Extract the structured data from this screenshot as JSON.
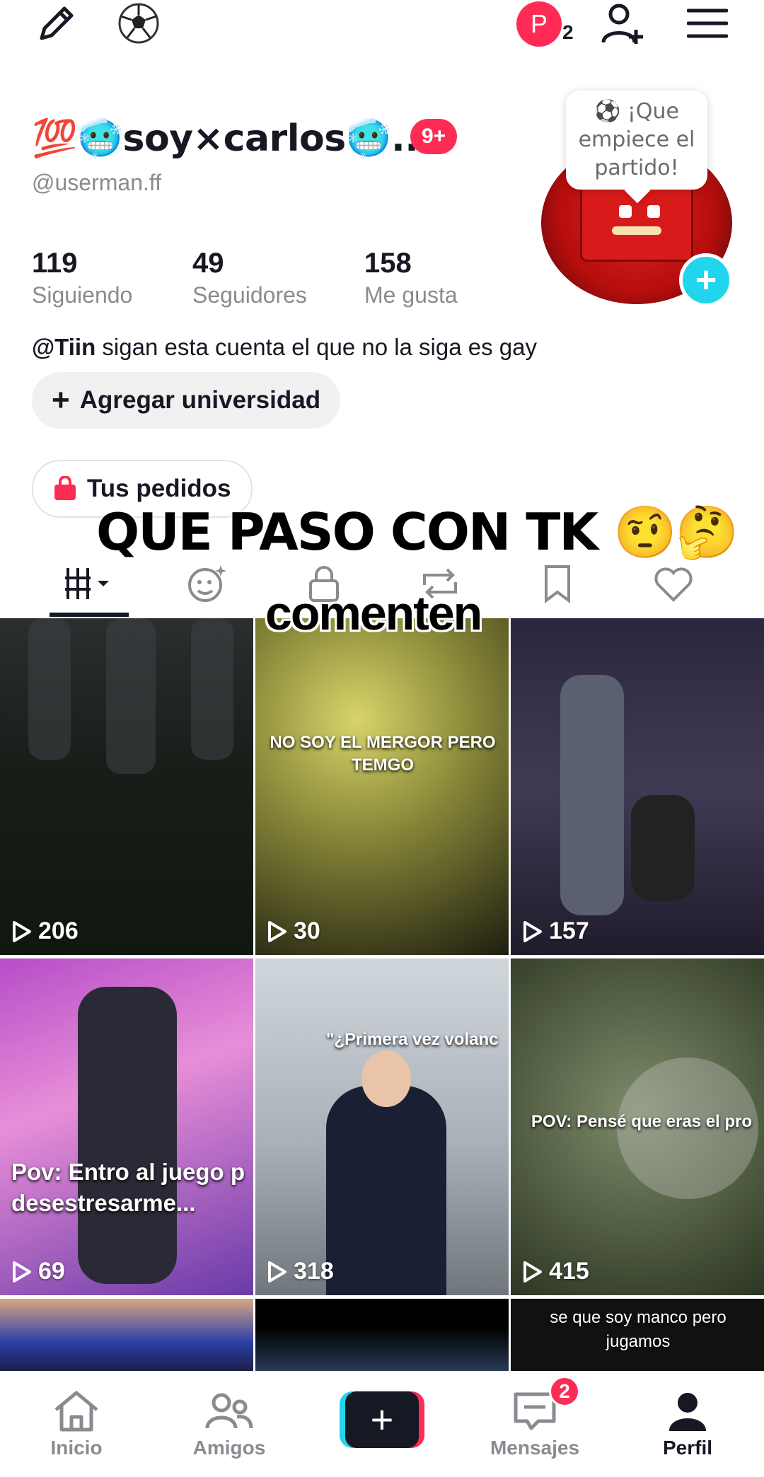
{
  "header": {
    "icons": {
      "edit": "pencil-icon",
      "ball": "soccer-ball-icon",
      "add_user": "add-user-icon",
      "menu": "menu-icon"
    },
    "account_initial": "P",
    "account_count": "2"
  },
  "profile": {
    "display_name": "💯🥶soy×carlos🥶...",
    "name_badge": "9+",
    "username": "@userman.ff",
    "bubble_text": "⚽ ¡Que empiece el partido!",
    "stats": [
      {
        "value": "119",
        "label": "Siguiendo"
      },
      {
        "value": "49",
        "label": "Seguidores"
      },
      {
        "value": "158",
        "label": "Me gusta"
      }
    ],
    "bio_mention": "@Tiin",
    "bio_text": " sigan esta cuenta el que no la siga es gay",
    "add_university": "Agregar universidad",
    "orders": "Tus pedidos"
  },
  "overlay": {
    "title": "QUE PASO CON TK 🤨🤔",
    "subtitle": "comenten"
  },
  "videos": [
    {
      "views": "206",
      "caption": ""
    },
    {
      "views": "30",
      "caption": "NO SOY EL MERGOR PERO TEMGO"
    },
    {
      "views": "157",
      "caption": ""
    },
    {
      "views": "69",
      "caption": "Pov: Entro al juego p desestresarme..."
    },
    {
      "views": "318",
      "caption": "\"¿Primera vez volanc"
    },
    {
      "views": "415",
      "caption": "POV: Pensé que eras el pro"
    },
    {
      "views": "",
      "caption": ""
    },
    {
      "views": "",
      "caption": ""
    },
    {
      "views": "",
      "caption": "se que soy manco pero jugamos"
    }
  ],
  "nav": {
    "home": "Inicio",
    "friends": "Amigos",
    "create": "+",
    "messages": "Mensajes",
    "messages_badge": "2",
    "profile": "Perfil"
  },
  "colors": {
    "accent": "#fe2c55",
    "teal": "#20d5ec",
    "text": "#161823",
    "muted": "#8a8b91"
  }
}
